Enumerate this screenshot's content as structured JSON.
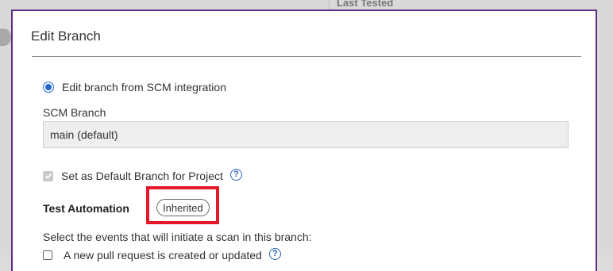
{
  "background": {
    "column_header": "Last Tested"
  },
  "modal": {
    "title": "Edit Branch",
    "radio_label": "Edit branch from SCM integration",
    "scm_branch_label": "SCM Branch",
    "scm_branch_value": "main (default)",
    "default_branch_label": "Set as Default Branch for Project",
    "test_automation_label": "Test Automation",
    "test_automation_badge": "Inherited",
    "events_description": "Select the events that will initiate a scan in this branch:",
    "event_pull_request": "A new pull request is created or updated"
  },
  "colors": {
    "modal_border": "#5e2d86",
    "radio_accent": "#2466d5",
    "highlight": "#e3192b",
    "help_icon": "#2a62b8"
  },
  "icons": {
    "help": "question-circle-icon",
    "check": "checkmark-icon"
  }
}
